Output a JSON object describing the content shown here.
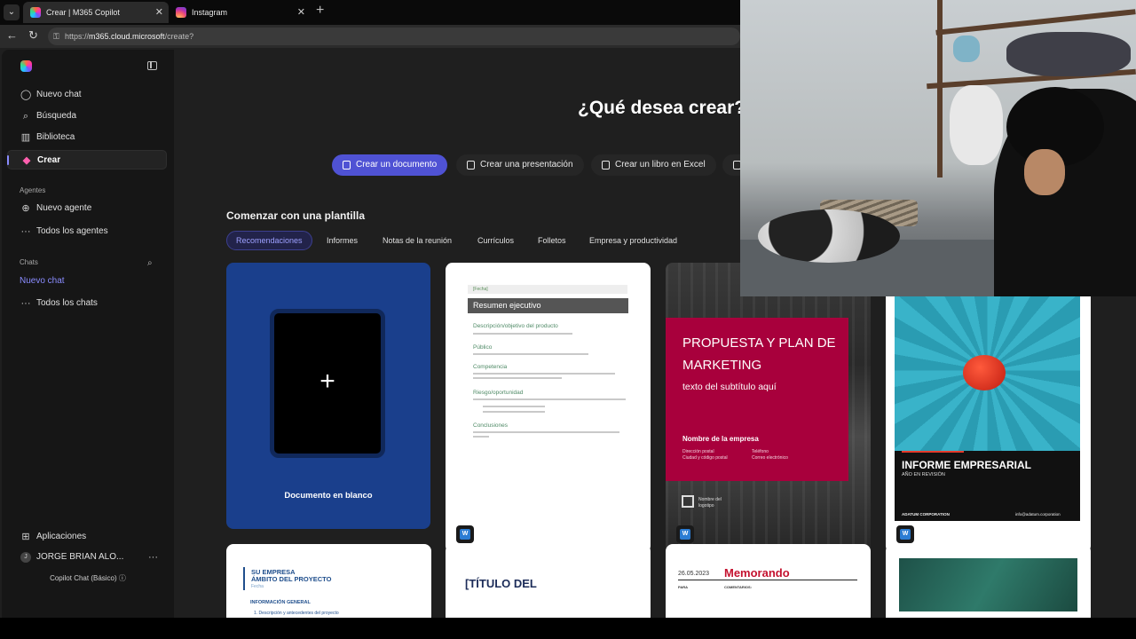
{
  "browser": {
    "tabs": [
      {
        "title": "Crear | M365 Copilot",
        "active": true
      },
      {
        "title": "Instagram",
        "active": false
      }
    ],
    "url_prefix": "https://",
    "url_host": "m365.cloud.microsoft",
    "url_path": "/create?"
  },
  "sidebar": {
    "nav": [
      {
        "label": "Nuevo chat",
        "icon": "chat-bubble-icon"
      },
      {
        "label": "Búsqueda",
        "icon": "search-icon"
      },
      {
        "label": "Biblioteca",
        "icon": "library-icon"
      },
      {
        "label": "Crear",
        "icon": "create-icon",
        "selected": true
      }
    ],
    "agents_label": "Agentes",
    "agents": [
      {
        "label": "Nuevo agente",
        "icon": "new-agent-icon"
      },
      {
        "label": "Todos los agentes",
        "icon": "more-icon"
      }
    ],
    "chats_label": "Chats",
    "chat_current": "Nuevo chat",
    "all_chats": "Todos los chats",
    "apps": "Aplicaciones",
    "user_name": "JORGE BRIAN ALO...",
    "user_initial": "J",
    "plan": "Copilot Chat (Básico)"
  },
  "main": {
    "heading": "¿Qué desea crear?",
    "create_buttons": [
      {
        "label": "Crear un documento",
        "active": true
      },
      {
        "label": "Crear una presentación"
      },
      {
        "label": "Crear un libro en Excel"
      }
    ],
    "templates_title": "Comenzar con una plantilla",
    "filters": [
      "Recomendaciones",
      "Informes",
      "Notas de la reunión",
      "Currículos",
      "Folletos",
      "Empresa y productividad"
    ],
    "cards": {
      "blank_label": "Documento en blanco",
      "exec": {
        "fecha": "[Fecha]",
        "bar": "Resumen ejecutivo",
        "sections": [
          "Descripción/objetivo del producto",
          "Público",
          "Competencia",
          "Riesgo/oportunidad",
          "Conclusiones"
        ]
      },
      "mkt": {
        "title": "PROPUESTA Y PLAN DE MARKETING",
        "subtitle": "texto del subtítulo aquí",
        "company": "Nombre de la empresa",
        "addr": "Dirección postal",
        "city": "Ciudad y código postal",
        "phone": "Teléfono",
        "email": "Correo electrónico",
        "logo": "Nombre del logotipo"
      },
      "inf": {
        "title": "INFORME EMPRESARIAL",
        "sub": "AÑO EN REVISIÓN",
        "corp": "ADATUM CORPORATION",
        "mail": "info@adatum.corporation"
      },
      "proj": {
        "line1": "SU EMPRESA",
        "line2": "ÁMBITO DEL PROYECTO",
        "fecha": "Fecha",
        "general": "INFORMACIÓN GENERAL",
        "desc": "1.  Descripción y antecedentes del proyecto"
      },
      "titulo": "[TÍTULO DEL",
      "memo": {
        "date": "26.05.2023",
        "title": "Memorando",
        "para": "PARA",
        "com": "COMENTARIOS:"
      }
    }
  }
}
